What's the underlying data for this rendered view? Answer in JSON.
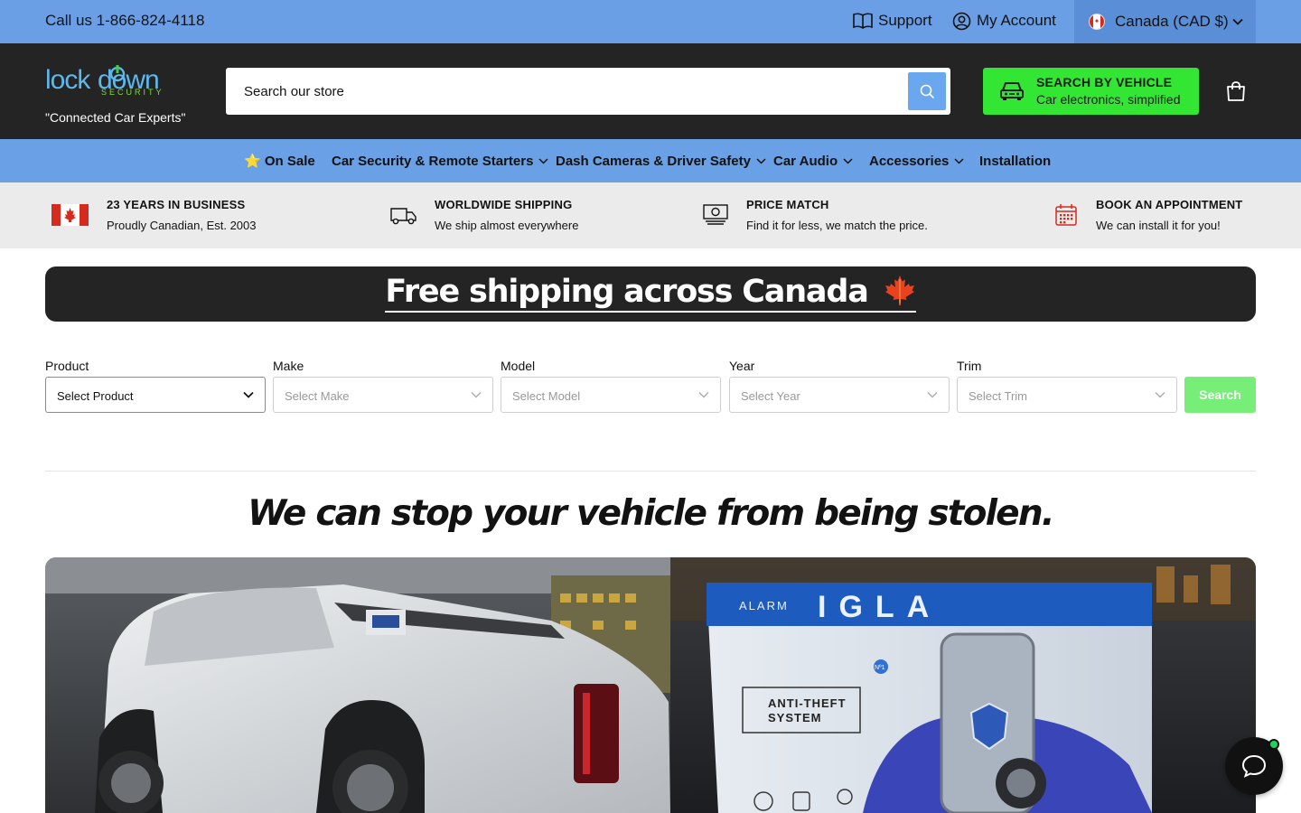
{
  "topbar": {
    "phone": "Call us 1-866-824-4118",
    "support": "Support",
    "account": "My Account",
    "country": "Canada (CAD $)"
  },
  "header": {
    "logo_text": "LockDown SECURITY",
    "tagline": "\"Connected Car Experts\"",
    "search_placeholder": "Search our store",
    "vehicle_title": "SEARCH BY VEHICLE",
    "vehicle_subtitle": "Car electronics, simplified"
  },
  "nav": {
    "items": [
      {
        "label": "⭐ On Sale",
        "dropdown": false
      },
      {
        "label": "Car Security & Remote Starters",
        "dropdown": true
      },
      {
        "label": "Dash Cameras & Driver Safety",
        "dropdown": true
      },
      {
        "label": "Car Audio",
        "dropdown": true
      },
      {
        "label": "Accessories",
        "dropdown": true
      },
      {
        "label": "Installation",
        "dropdown": false
      }
    ]
  },
  "trust": [
    {
      "title": "23 YEARS IN BUSINESS",
      "desc": "Proudly Canadian, Est. 2003",
      "icon": "canada-flag-icon"
    },
    {
      "title": "WORLDWIDE SHIPPING",
      "desc": "We ship almost everywhere",
      "icon": "truck-icon"
    },
    {
      "title": "PRICE MATCH",
      "desc": "Find it for less, we match the price.",
      "icon": "cash-icon"
    },
    {
      "title": "BOOK AN APPOINTMENT",
      "desc": "We can install it for you!",
      "icon": "calendar-icon"
    }
  ],
  "banner": {
    "text": "Free shipping across Canada",
    "icon": "maple-leaf-icon"
  },
  "finder": {
    "fields": [
      {
        "label": "Product",
        "placeholder": "Select Product"
      },
      {
        "label": "Make",
        "placeholder": "Select Make"
      },
      {
        "label": "Model",
        "placeholder": "Select Model"
      },
      {
        "label": "Year",
        "placeholder": "Select Year"
      },
      {
        "label": "Trim",
        "placeholder": "Select Trim"
      }
    ],
    "button": "Search"
  },
  "headline": "We can stop your vehicle from being stolen.",
  "hero": {
    "box_brand": "ALARM IGLA",
    "box_label": "ANTI-THEFT SYSTEM",
    "box_badge": "Nº1"
  },
  "colors": {
    "topbar": "#6a9fe6",
    "header": "#242424",
    "vehicle_button": "#33e633",
    "search_button": "#6aa7ee",
    "finder_button": "#77ee77"
  }
}
